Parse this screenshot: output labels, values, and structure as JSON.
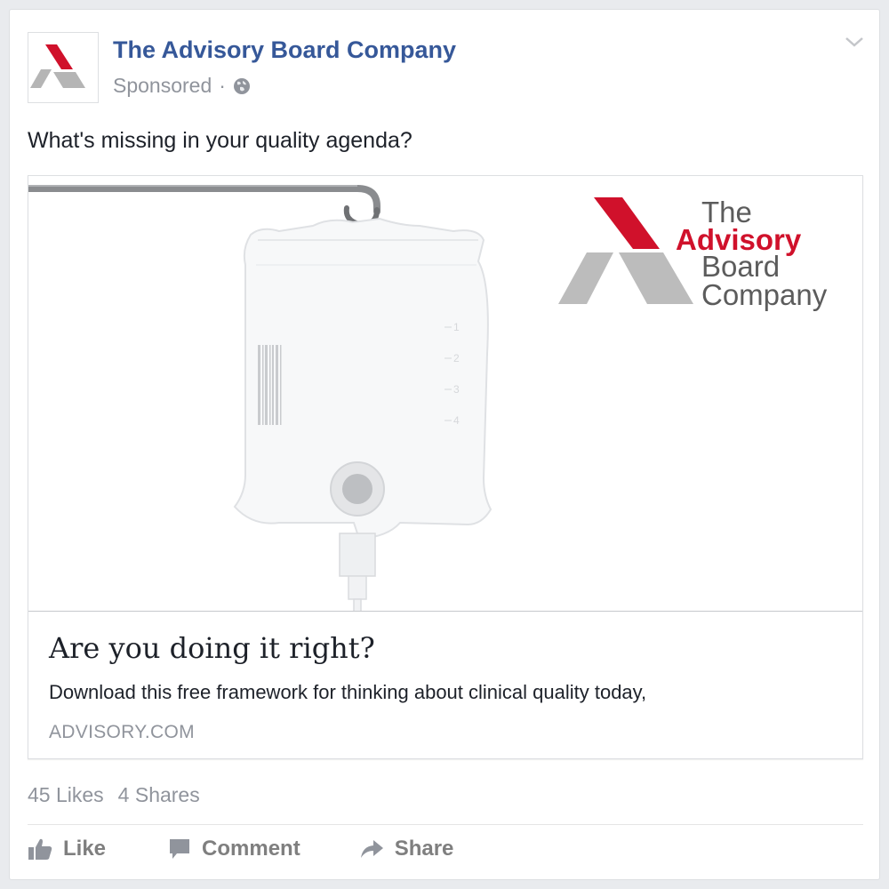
{
  "post": {
    "page_name": "The Advisory Board Company",
    "sponsored_label": "Sponsored",
    "separator": "·",
    "message": "What's missing in your quality agenda?"
  },
  "link": {
    "image_brand": {
      "line1": "The",
      "line2": "Advisory",
      "line3": "Board",
      "line4": "Company"
    },
    "bag_scale": [
      "1",
      "2",
      "3",
      "4"
    ],
    "title": "Are you doing it right?",
    "description": "Download this free framework for thinking about clinical quality today,",
    "domain": "ADVISORY.COM"
  },
  "engagement": {
    "likes": "45 Likes",
    "shares": "4 Shares"
  },
  "actions": {
    "like": "Like",
    "comment": "Comment",
    "share": "Share"
  },
  "icons": {
    "avatar": "advisory-board-logo",
    "audience": "globe-icon",
    "menu": "chevron-down-icon",
    "like": "thumbs-up-icon",
    "comment": "comment-bubble-icon",
    "share": "share-arrow-icon"
  },
  "colors": {
    "page_link": "#365899",
    "brand_red": "#d0112b",
    "brand_gray": "#b5b5b5",
    "meta_text": "#90949c",
    "action_text": "#7f7f7f"
  }
}
